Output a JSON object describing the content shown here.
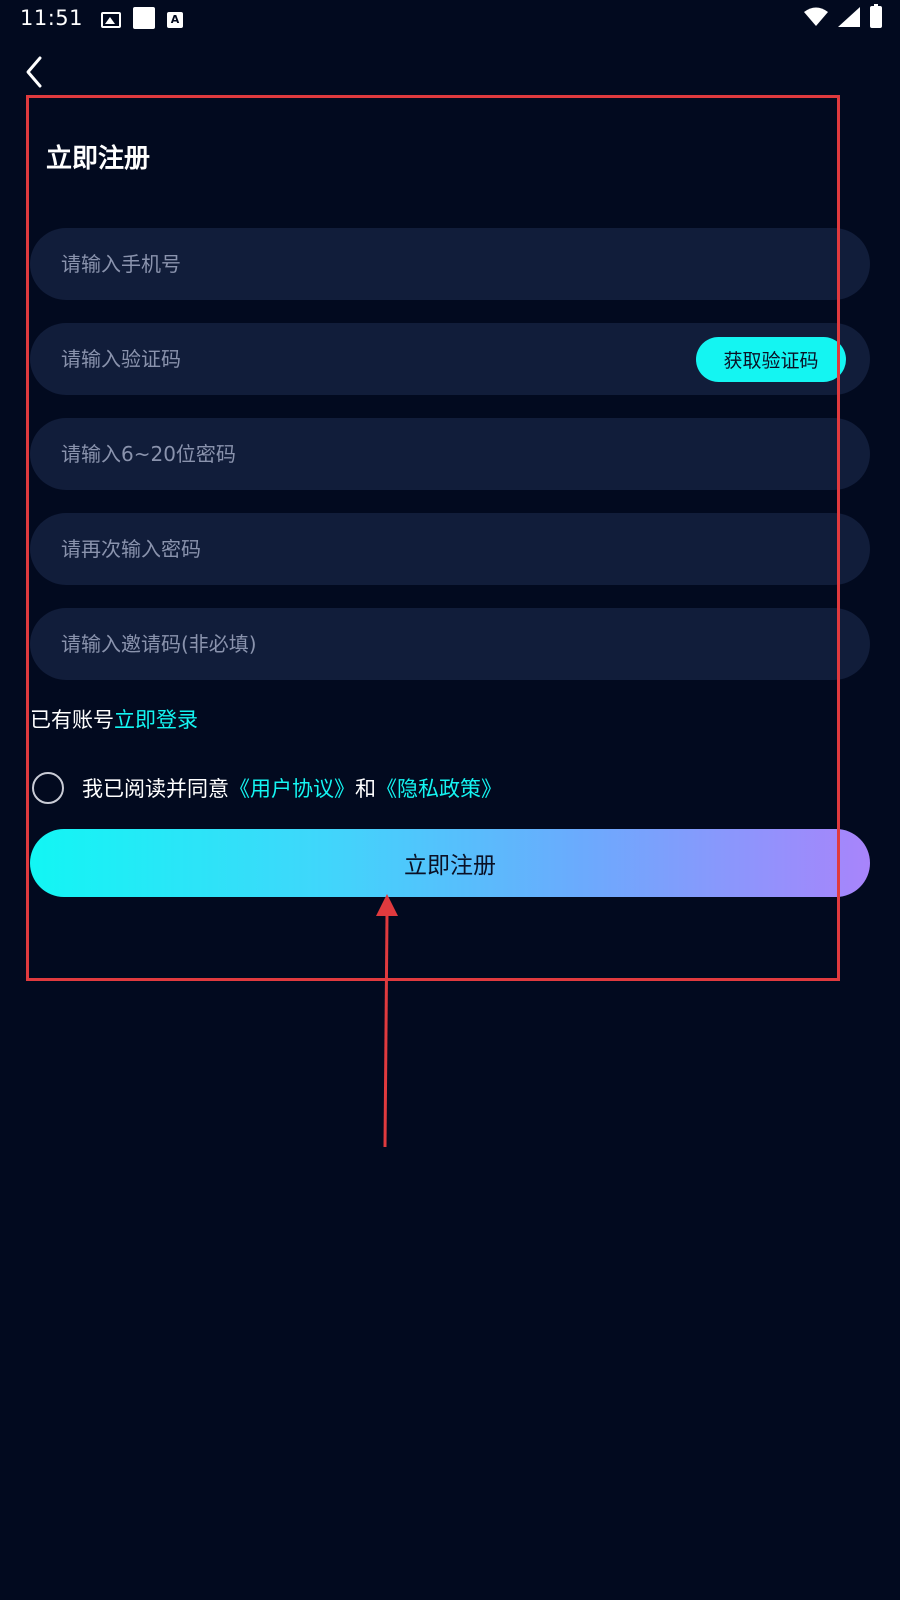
{
  "status_bar": {
    "time": "11:51",
    "icons": [
      "image-icon",
      "square-icon",
      "a-icon",
      "wifi-icon",
      "signal-icon",
      "battery-icon"
    ]
  },
  "header": {
    "back_icon": "chevron-left-icon"
  },
  "form": {
    "title": "立即注册",
    "phone_placeholder": "请输入手机号",
    "code_placeholder": "请输入验证码",
    "get_code_label": "获取验证码",
    "password_placeholder": "请输入6~20位密码",
    "confirm_password_placeholder": "请再次输入密码",
    "invite_placeholder": "请输入邀请码(非必填)",
    "has_account_text": "已有账号",
    "login_link": "立即登录",
    "agree_text": "我已阅读并同意",
    "user_agreement": "《用户协议》",
    "and_text": "和",
    "privacy_policy": "《隐私政策》",
    "register_label": "立即注册"
  },
  "colors": {
    "background": "#020a1f",
    "field_bg": "#111d3a",
    "accent": "#14f5f2",
    "gradient_end": "#a884fb",
    "annotation": "#e03a3e"
  }
}
